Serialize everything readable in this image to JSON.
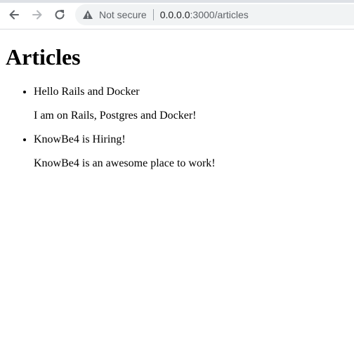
{
  "browser": {
    "security_label": "Not secure",
    "url_host": "0.0.0.0",
    "url_path": ":3000/articles",
    "icons": [
      "back-arrow-icon",
      "forward-arrow-icon",
      "reload-icon",
      "warning-icon"
    ]
  },
  "page": {
    "heading": "Articles",
    "articles": [
      {
        "title": "Hello Rails and Docker",
        "body": "I am on Rails, Postgres and Docker!"
      },
      {
        "title": "KnowBe4 is Hiring!",
        "body": "KnowBe4 is an awesome place to work!"
      }
    ]
  }
}
